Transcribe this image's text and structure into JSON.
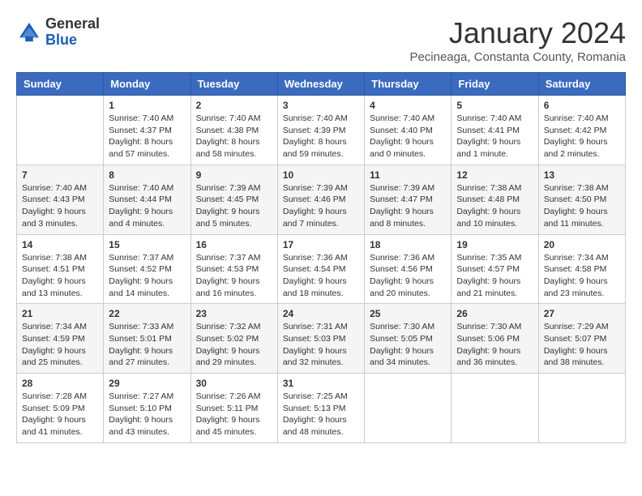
{
  "logo": {
    "general": "General",
    "blue": "Blue"
  },
  "header": {
    "title": "January 2024",
    "subtitle": "Pecineaga, Constanta County, Romania"
  },
  "weekdays": [
    "Sunday",
    "Monday",
    "Tuesday",
    "Wednesday",
    "Thursday",
    "Friday",
    "Saturday"
  ],
  "weeks": [
    [
      {
        "day": "",
        "content": ""
      },
      {
        "day": "1",
        "content": "Sunrise: 7:40 AM\nSunset: 4:37 PM\nDaylight: 8 hours\nand 57 minutes."
      },
      {
        "day": "2",
        "content": "Sunrise: 7:40 AM\nSunset: 4:38 PM\nDaylight: 8 hours\nand 58 minutes."
      },
      {
        "day": "3",
        "content": "Sunrise: 7:40 AM\nSunset: 4:39 PM\nDaylight: 8 hours\nand 59 minutes."
      },
      {
        "day": "4",
        "content": "Sunrise: 7:40 AM\nSunset: 4:40 PM\nDaylight: 9 hours\nand 0 minutes."
      },
      {
        "day": "5",
        "content": "Sunrise: 7:40 AM\nSunset: 4:41 PM\nDaylight: 9 hours\nand 1 minute."
      },
      {
        "day": "6",
        "content": "Sunrise: 7:40 AM\nSunset: 4:42 PM\nDaylight: 9 hours\nand 2 minutes."
      }
    ],
    [
      {
        "day": "7",
        "content": "Sunrise: 7:40 AM\nSunset: 4:43 PM\nDaylight: 9 hours\nand 3 minutes."
      },
      {
        "day": "8",
        "content": "Sunrise: 7:40 AM\nSunset: 4:44 PM\nDaylight: 9 hours\nand 4 minutes."
      },
      {
        "day": "9",
        "content": "Sunrise: 7:39 AM\nSunset: 4:45 PM\nDaylight: 9 hours\nand 5 minutes."
      },
      {
        "day": "10",
        "content": "Sunrise: 7:39 AM\nSunset: 4:46 PM\nDaylight: 9 hours\nand 7 minutes."
      },
      {
        "day": "11",
        "content": "Sunrise: 7:39 AM\nSunset: 4:47 PM\nDaylight: 9 hours\nand 8 minutes."
      },
      {
        "day": "12",
        "content": "Sunrise: 7:38 AM\nSunset: 4:48 PM\nDaylight: 9 hours\nand 10 minutes."
      },
      {
        "day": "13",
        "content": "Sunrise: 7:38 AM\nSunset: 4:50 PM\nDaylight: 9 hours\nand 11 minutes."
      }
    ],
    [
      {
        "day": "14",
        "content": "Sunrise: 7:38 AM\nSunset: 4:51 PM\nDaylight: 9 hours\nand 13 minutes."
      },
      {
        "day": "15",
        "content": "Sunrise: 7:37 AM\nSunset: 4:52 PM\nDaylight: 9 hours\nand 14 minutes."
      },
      {
        "day": "16",
        "content": "Sunrise: 7:37 AM\nSunset: 4:53 PM\nDaylight: 9 hours\nand 16 minutes."
      },
      {
        "day": "17",
        "content": "Sunrise: 7:36 AM\nSunset: 4:54 PM\nDaylight: 9 hours\nand 18 minutes."
      },
      {
        "day": "18",
        "content": "Sunrise: 7:36 AM\nSunset: 4:56 PM\nDaylight: 9 hours\nand 20 minutes."
      },
      {
        "day": "19",
        "content": "Sunrise: 7:35 AM\nSunset: 4:57 PM\nDaylight: 9 hours\nand 21 minutes."
      },
      {
        "day": "20",
        "content": "Sunrise: 7:34 AM\nSunset: 4:58 PM\nDaylight: 9 hours\nand 23 minutes."
      }
    ],
    [
      {
        "day": "21",
        "content": "Sunrise: 7:34 AM\nSunset: 4:59 PM\nDaylight: 9 hours\nand 25 minutes."
      },
      {
        "day": "22",
        "content": "Sunrise: 7:33 AM\nSunset: 5:01 PM\nDaylight: 9 hours\nand 27 minutes."
      },
      {
        "day": "23",
        "content": "Sunrise: 7:32 AM\nSunset: 5:02 PM\nDaylight: 9 hours\nand 29 minutes."
      },
      {
        "day": "24",
        "content": "Sunrise: 7:31 AM\nSunset: 5:03 PM\nDaylight: 9 hours\nand 32 minutes."
      },
      {
        "day": "25",
        "content": "Sunrise: 7:30 AM\nSunset: 5:05 PM\nDaylight: 9 hours\nand 34 minutes."
      },
      {
        "day": "26",
        "content": "Sunrise: 7:30 AM\nSunset: 5:06 PM\nDaylight: 9 hours\nand 36 minutes."
      },
      {
        "day": "27",
        "content": "Sunrise: 7:29 AM\nSunset: 5:07 PM\nDaylight: 9 hours\nand 38 minutes."
      }
    ],
    [
      {
        "day": "28",
        "content": "Sunrise: 7:28 AM\nSunset: 5:09 PM\nDaylight: 9 hours\nand 41 minutes."
      },
      {
        "day": "29",
        "content": "Sunrise: 7:27 AM\nSunset: 5:10 PM\nDaylight: 9 hours\nand 43 minutes."
      },
      {
        "day": "30",
        "content": "Sunrise: 7:26 AM\nSunset: 5:11 PM\nDaylight: 9 hours\nand 45 minutes."
      },
      {
        "day": "31",
        "content": "Sunrise: 7:25 AM\nSunset: 5:13 PM\nDaylight: 9 hours\nand 48 minutes."
      },
      {
        "day": "",
        "content": ""
      },
      {
        "day": "",
        "content": ""
      },
      {
        "day": "",
        "content": ""
      }
    ]
  ]
}
